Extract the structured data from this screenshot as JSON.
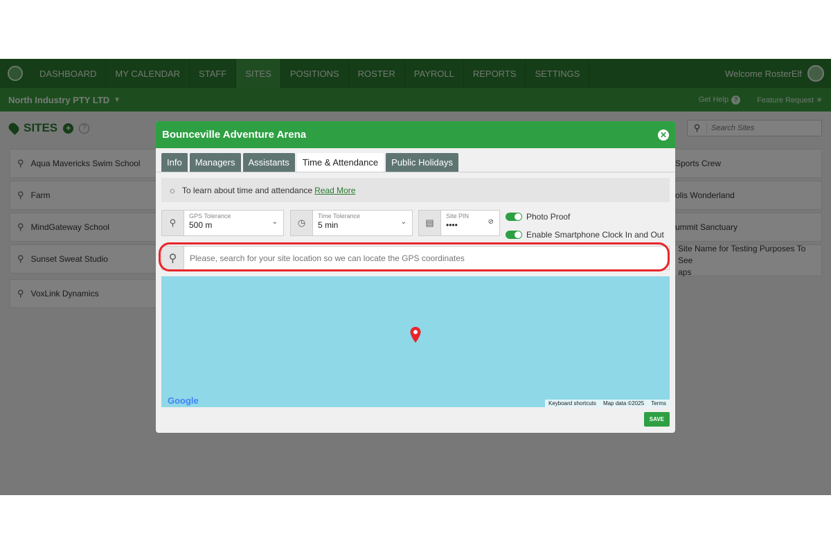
{
  "nav": {
    "items": [
      "DASHBOARD",
      "MY CALENDAR",
      "STAFF",
      "SITES",
      "POSITIONS",
      "ROSTER",
      "PAYROLL",
      "REPORTS",
      "SETTINGS"
    ],
    "active": "SITES",
    "welcome": "Welcome RosterElf"
  },
  "subnav": {
    "company": "North Industry PTY LTD",
    "get_help": "Get Help",
    "feature_request": "Feature Request"
  },
  "sites_page": {
    "title": "SITES",
    "search_placeholder": "Search Sites",
    "left_column": [
      "Aqua Mavericks Swim School",
      "Farm",
      "MindGateway School",
      "Sunset Sweat Studio",
      "VoxLink Dynamics"
    ],
    "right_column": [
      "Sports Crew",
      "olis Wonderland",
      "ummit Sanctuary",
      "Site Name for Testing Purposes To See",
      "aps"
    ]
  },
  "modal": {
    "title": "Bounceville Adventure Arena",
    "tabs": [
      "Info",
      "Managers",
      "Assistants",
      "Time & Attendance",
      "Public Holidays"
    ],
    "active_tab": "Time & Attendance",
    "info_text": "To learn about time and attendance",
    "info_link": "Read More",
    "gps_tolerance": {
      "label": "GPS Tolerance",
      "value": "500 m"
    },
    "time_tolerance": {
      "label": "Time Tolerance",
      "value": "5 min"
    },
    "site_pin": {
      "label": "Site PIN",
      "value": "••••"
    },
    "photo_proof": {
      "label": "Photo Proof",
      "enabled": true
    },
    "smartphone_clock": {
      "label": "Enable Smartphone Clock In and Out",
      "enabled": true
    },
    "location_placeholder": "Please, search for your site location so we can locate the GPS coordinates",
    "map": {
      "provider": "Google",
      "keyboard_shortcuts": "Keyboard shortcuts",
      "map_data": "Map data ©2025",
      "terms": "Terms"
    },
    "save_label": "SAVE"
  },
  "colors": {
    "brand_dark": "#2a7a2e",
    "brand": "#2ea043",
    "highlight": "#e8252b",
    "map_water": "#8fd8e8"
  }
}
